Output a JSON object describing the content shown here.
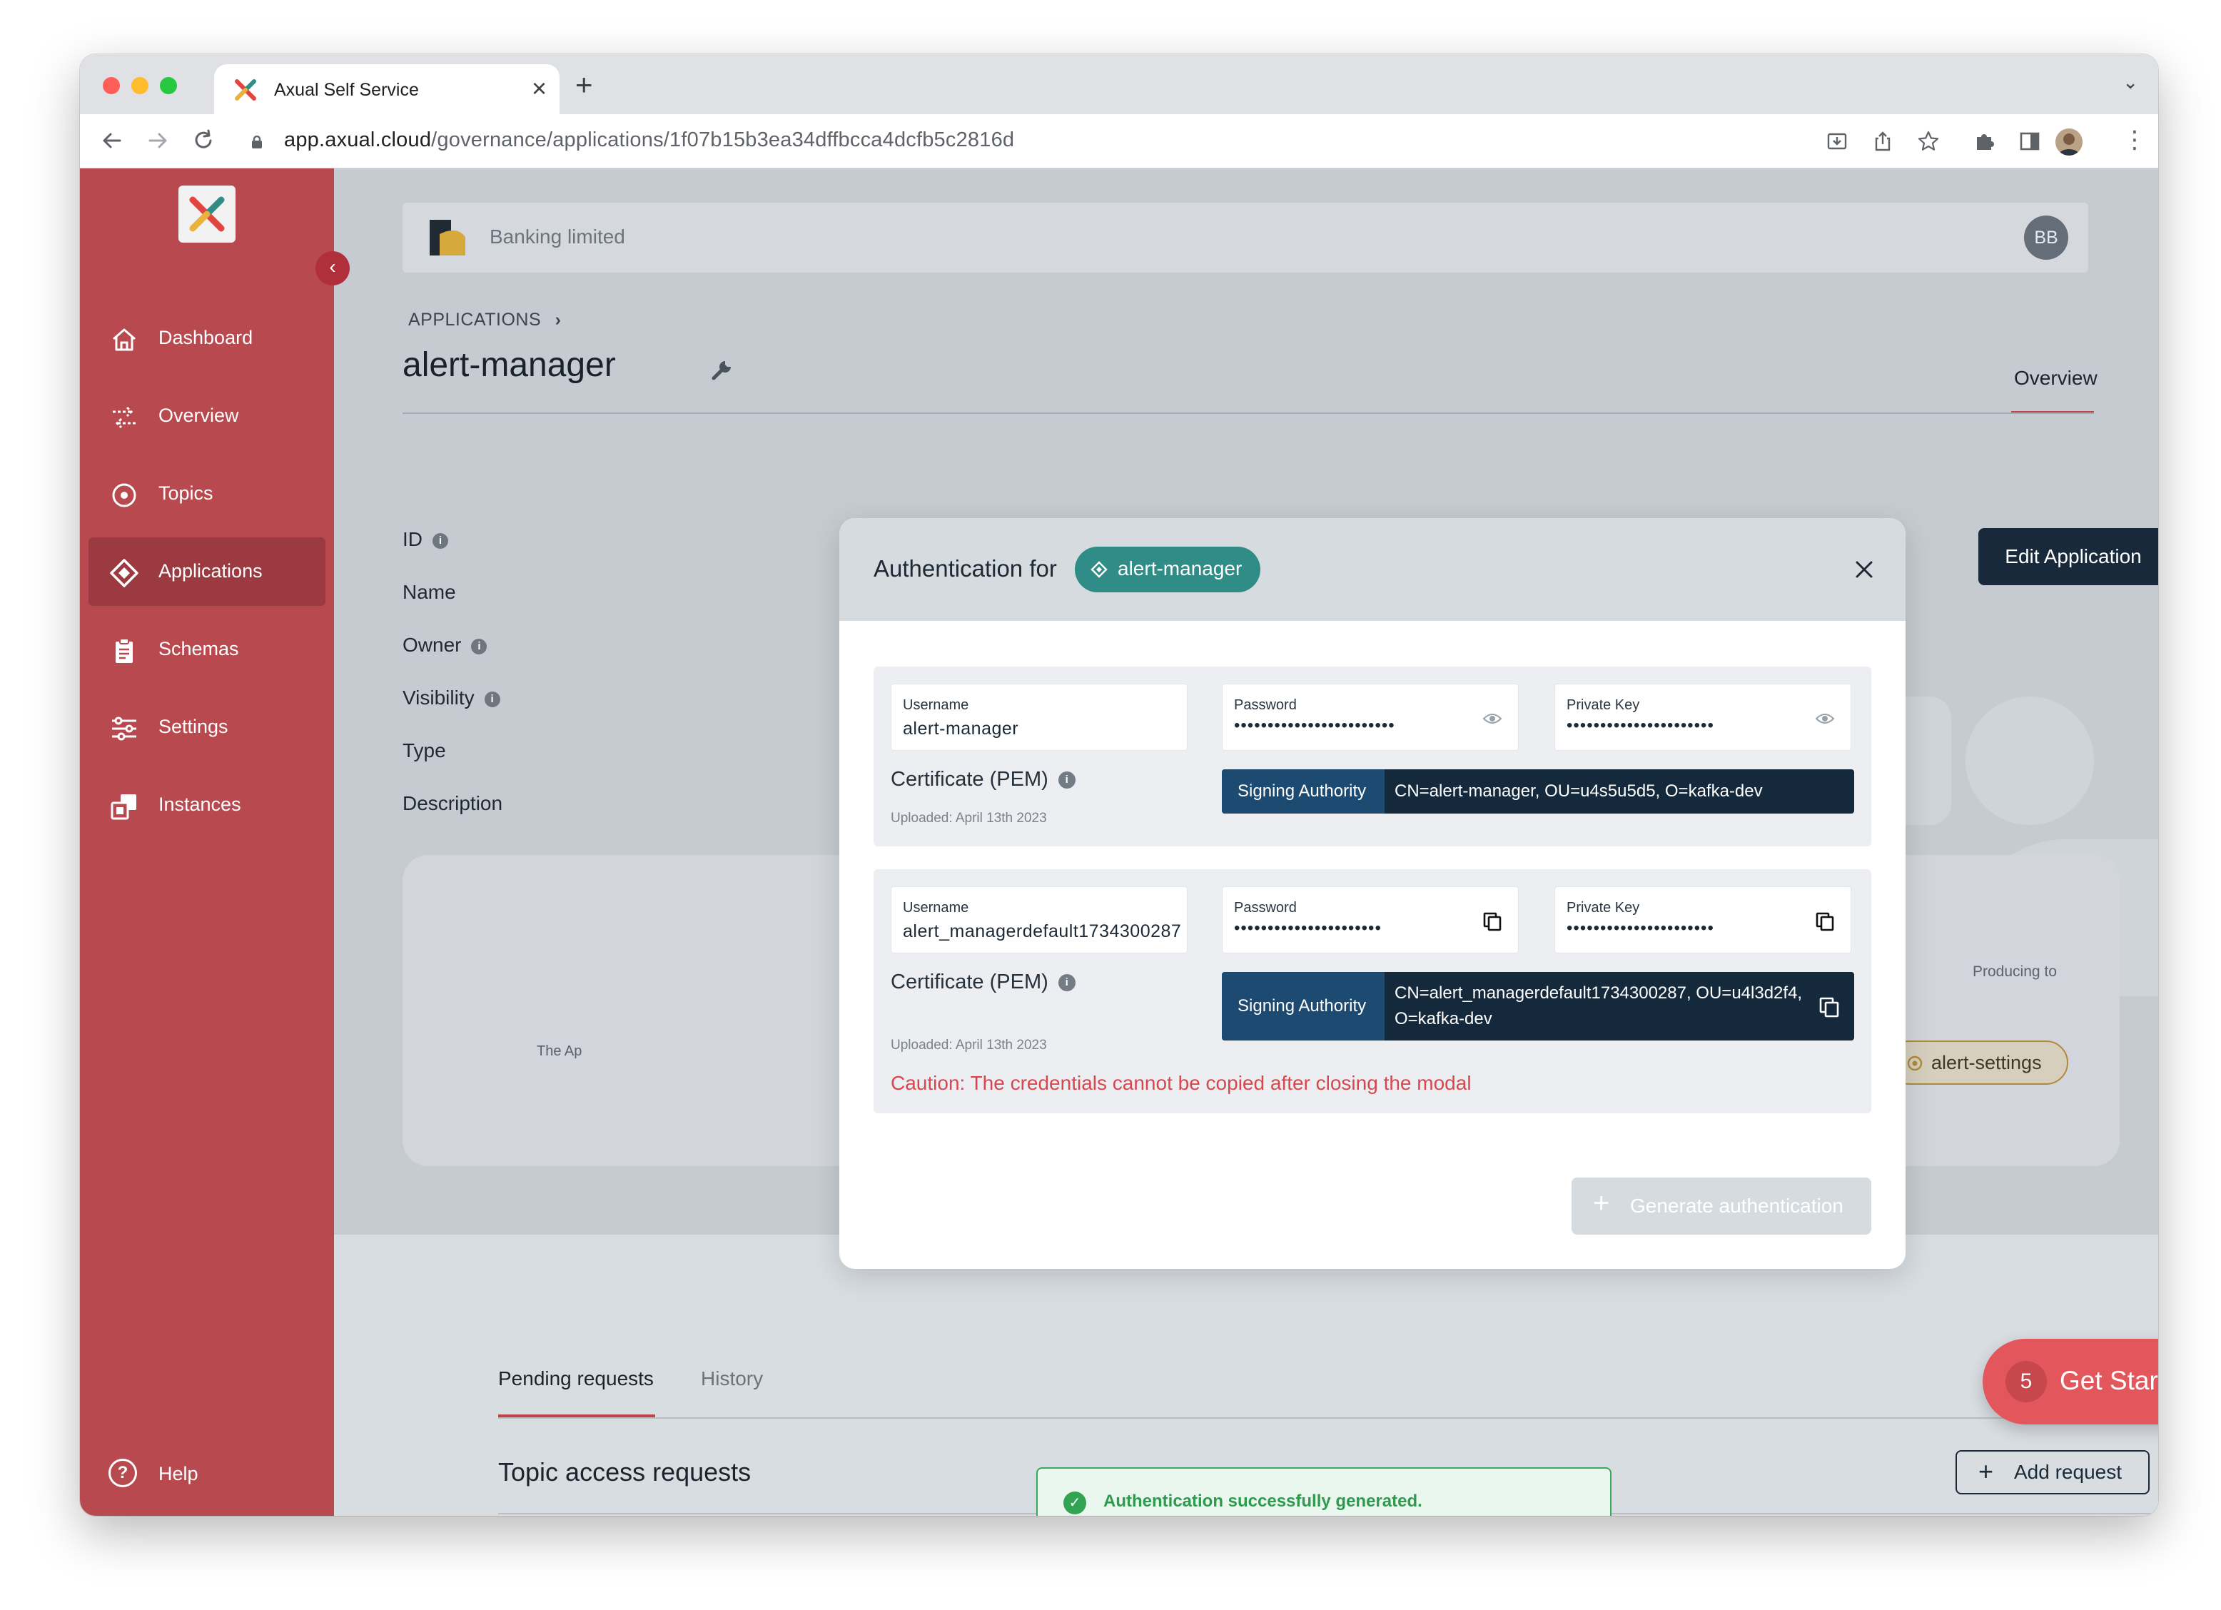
{
  "browser": {
    "tab_title": "Axual Self Service",
    "url_host": "app.axual.cloud",
    "url_path": "/governance/applications/1f07b15b3ea34dffbcca4dcfb5c2816d"
  },
  "org": {
    "name": "Banking limited",
    "avatar_initials": "BB"
  },
  "sidebar": {
    "items": [
      {
        "label": "Dashboard",
        "icon": "home-icon"
      },
      {
        "label": "Overview",
        "icon": "flow-icon"
      },
      {
        "label": "Topics",
        "icon": "topic-icon"
      },
      {
        "label": "Applications",
        "icon": "application-icon",
        "active": true
      },
      {
        "label": "Schemas",
        "icon": "clipboard-icon"
      },
      {
        "label": "Settings",
        "icon": "sliders-icon"
      },
      {
        "label": "Instances",
        "icon": "instances-icon"
      }
    ],
    "help_label": "Help"
  },
  "page": {
    "breadcrumb": "APPLICATIONS",
    "title": "alert-manager",
    "tab_overview": "Overview",
    "edit_button": "Edit Application",
    "fields": [
      "ID",
      "Name",
      "Owner",
      "Visibility",
      "Type",
      "Description"
    ],
    "flow_text_left": "The Ap",
    "producing_to": "Producing to",
    "topic_pill": "alert-settings"
  },
  "lower": {
    "tabs": [
      "Pending requests",
      "History"
    ],
    "section_title": "Topic access requests",
    "add_request": "Add request"
  },
  "get_started": {
    "count": "5",
    "label": "Get Started"
  },
  "toast": {
    "message": "Authentication successfully generated."
  },
  "modal": {
    "title": "Authentication for",
    "app_chip": "alert-manager",
    "credentials": [
      {
        "username_label": "Username",
        "username": "alert-manager",
        "password_label": "Password",
        "password": "••••••••••••••••••••••••",
        "private_key_label": "Private Key",
        "private_key": "••••••••••••••••••••••",
        "cert_label": "Certificate (PEM)",
        "uploaded": "Uploaded: April 13th 2023",
        "signing_authority_label": "Signing Authority",
        "signing_authority_line1": "CN=alert-manager, OU=u4s5u5d5, O=kafka-dev",
        "signing_authority_line2": ""
      },
      {
        "username_label": "Username",
        "username": "alert_managerdefault1734300287",
        "password_label": "Password",
        "password": "••••••••••••••••••••••",
        "private_key_label": "Private Key",
        "private_key": "••••••••••••••••••••••",
        "cert_label": "Certificate (PEM)",
        "uploaded": "Uploaded: April 13th 2023",
        "signing_authority_label": "Signing Authority",
        "signing_authority_line1": "CN=alert_managerdefault1734300287, OU=u4l3d2f4,",
        "signing_authority_line2": "O=kafka-dev",
        "caution": "Caution: The credentials cannot be copied after closing the modal"
      }
    ],
    "generate_button": "Generate authentication"
  },
  "colors": {
    "sidebar": "#b8494f",
    "sidebar_active": "#9b3a40",
    "primary_dark": "#17293a",
    "chip_teal": "#2f8c86",
    "caution_red": "#d9474d",
    "success_green": "#31a452",
    "get_started": "#e3575c"
  }
}
